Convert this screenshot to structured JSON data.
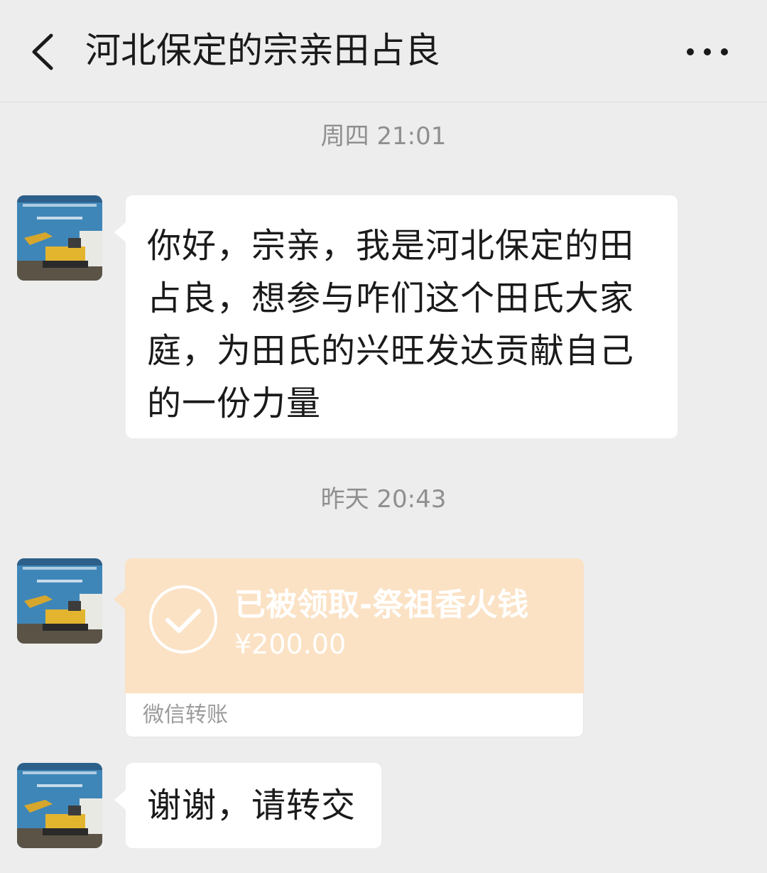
{
  "header": {
    "title": "河北保定的宗亲田占良",
    "back_icon": "chevron-left-icon",
    "more_icon": "more-dots-icon"
  },
  "colors": {
    "background": "#ededed",
    "bubble": "#ffffff",
    "transfer_received": "#fbe2c5",
    "timestamp_text": "#8f8f8f"
  },
  "messages": [
    {
      "timestamp": "周四 21:01",
      "type": "text",
      "sender": "incoming",
      "text": "你好，宗亲，我是河北保定的田占良，想参与咋们这个田氏大家庭，为田氏的兴旺发达贡献自己的一份力量"
    },
    {
      "timestamp": "昨天 20:43",
      "type": "transfer",
      "sender": "incoming",
      "status_title": "已被领取-祭祖香火钱",
      "amount": "¥200.00",
      "footer": "微信转账",
      "icon": "check-circle-icon"
    },
    {
      "type": "text",
      "sender": "incoming",
      "text": "谢谢，请转交"
    }
  ]
}
